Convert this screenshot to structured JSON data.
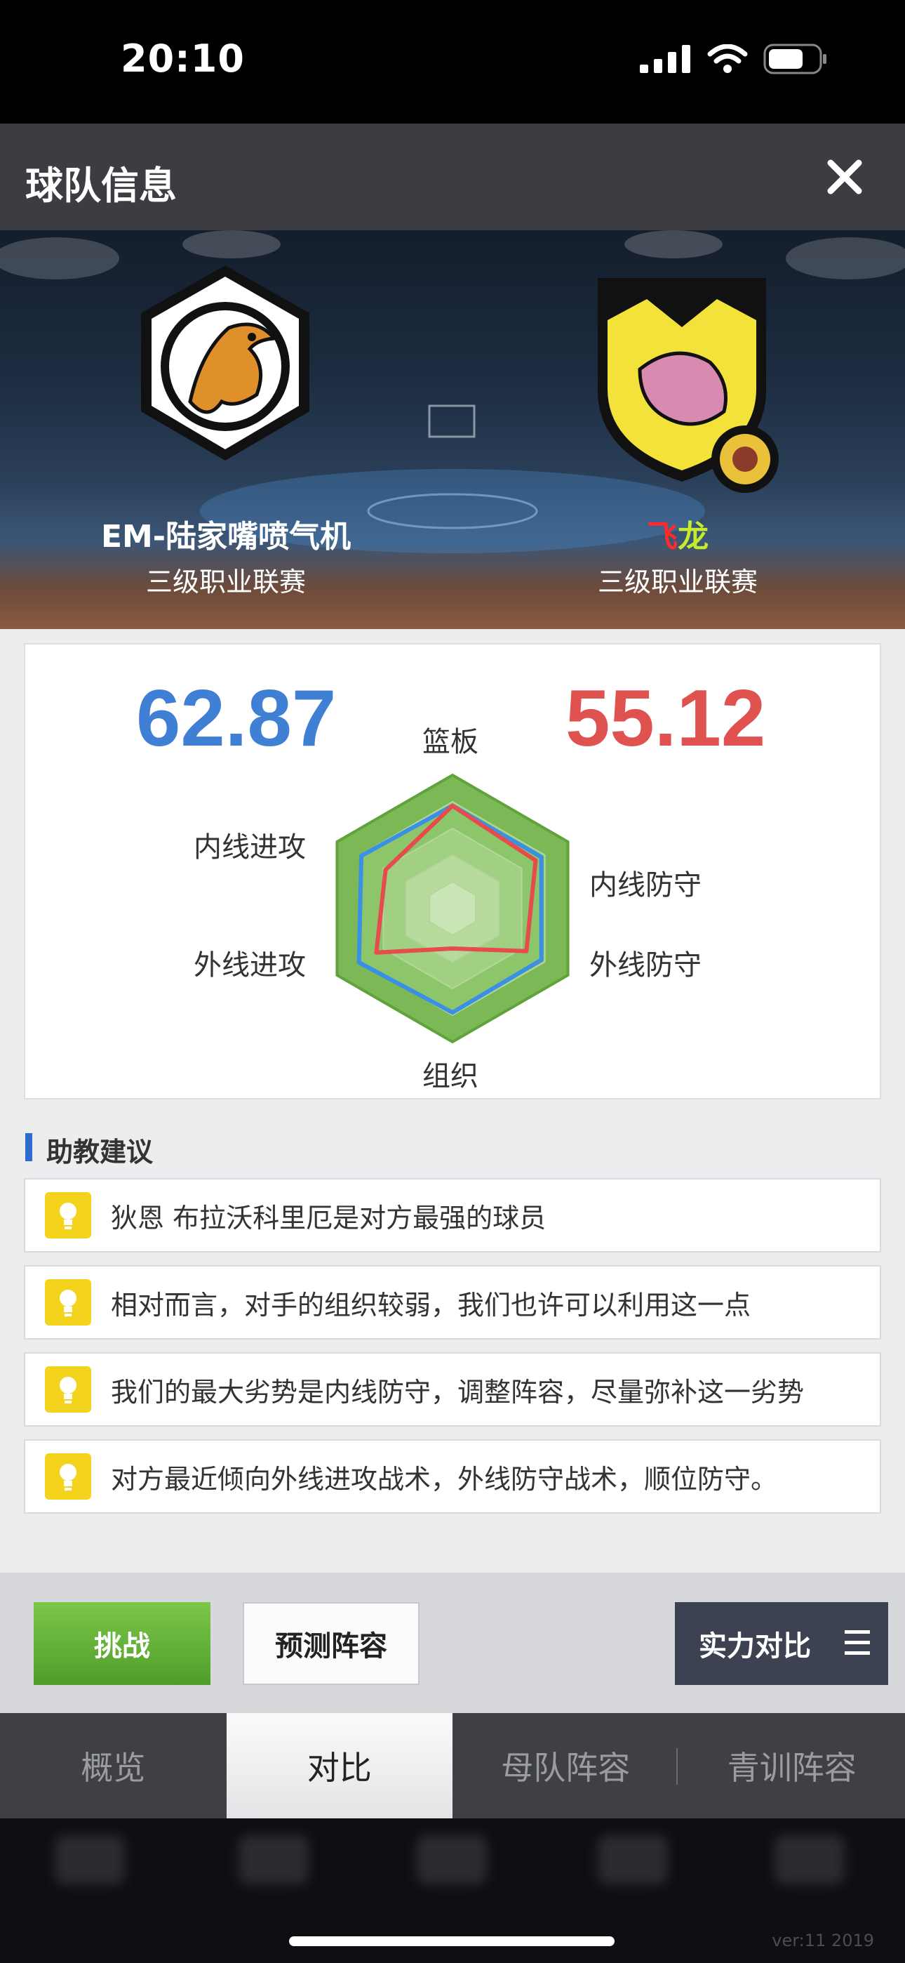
{
  "status_bar": {
    "time": "20:10"
  },
  "header": {
    "title": "球队信息"
  },
  "teams": {
    "home": {
      "name": "EM-陆家嘴喷气机",
      "league": "三级职业联赛",
      "score": "62.87"
    },
    "away": {
      "name_part1": "飞",
      "name_part2": "龙",
      "league": "三级职业联赛",
      "score": "55.12"
    }
  },
  "radar": {
    "axes": [
      "篮板",
      "内线防守",
      "外线防守",
      "组织",
      "外线进攻",
      "内线进攻"
    ],
    "series": [
      {
        "team": "EM-陆家嘴喷气机",
        "color": "#3a8fe6",
        "values": [
          0.77,
          0.77,
          0.77,
          0.78,
          0.81,
          0.79
        ]
      },
      {
        "team": "飞龙",
        "color": "#e64c4c",
        "values": [
          0.77,
          0.72,
          0.64,
          0.3,
          0.66,
          0.58
        ]
      }
    ]
  },
  "advice": {
    "title": "助教建议",
    "items": [
      "狄恩 布拉沃科里厄是对方最强的球员",
      "相对而言，对手的组织较弱，我们也许可以利用这一点",
      "我们的最大劣势是内线防守，调整阵容，尽量弥补这一劣势",
      "对方最近倾向外线进攻战术，外线防守战术，顺位防守。"
    ]
  },
  "actions": {
    "challenge": "挑战",
    "predict": "预测阵容",
    "strength": "实力对比"
  },
  "tabs": [
    "概览",
    "对比",
    "母队阵容",
    "青训阵容"
  ],
  "footer": {
    "version": "ver:11  2019"
  },
  "colors": {
    "home_score": "#3f7fd4",
    "away_score": "#e0524f",
    "accent_green": "#5fae34"
  }
}
